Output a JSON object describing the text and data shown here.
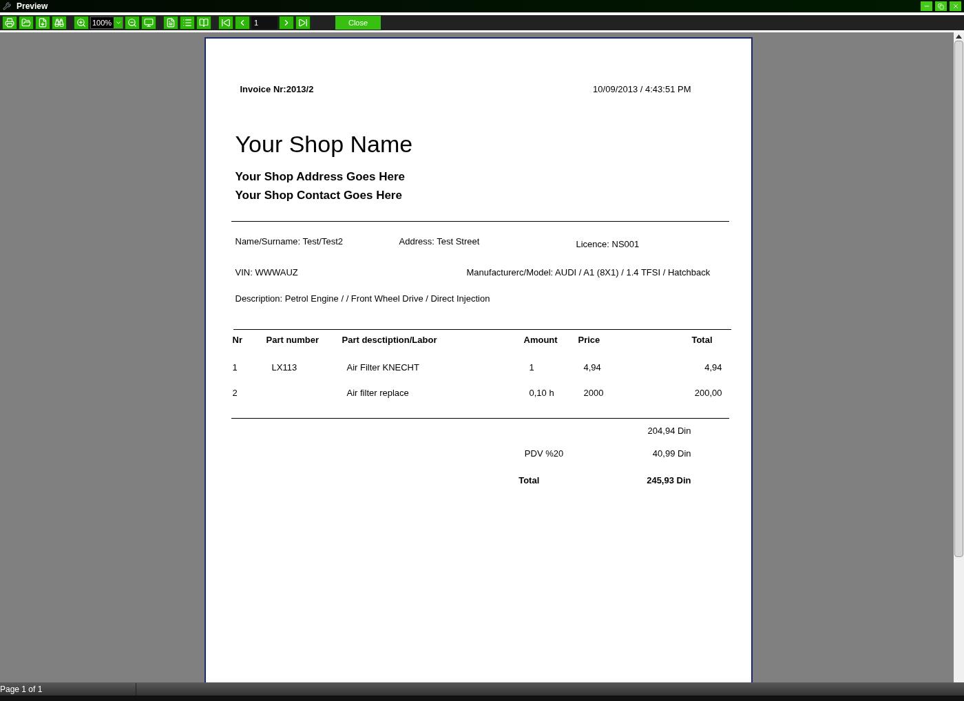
{
  "window": {
    "title": "Preview"
  },
  "toolbar": {
    "zoom": "100%",
    "page": "1",
    "close": "Close"
  },
  "invoice": {
    "number": "Invoice Nr:2013/2",
    "datetime": "10/09/2013 / 4:43:51 PM",
    "shop_name": "Your Shop Name",
    "shop_address": "Your Shop Address Goes Here",
    "shop_contact": "Your Shop Contact Goes Here",
    "name": "Name/Surname: Test/Test2",
    "address": "Address: Test Street",
    "licence": "Licence: NS001",
    "vin": "VIN: WWWAUZ",
    "model": "Manufacturerc/Model: AUDI / A1 (8X1) / 1.4 TFSI / Hatchback",
    "description": "Description: Petrol Engine /  / Front Wheel Drive / Direct Injection",
    "columns": [
      "Nr",
      "Part number",
      "Part desctiption/Labor",
      "Amount",
      "Price",
      "Total"
    ],
    "rows": [
      {
        "nr": "1",
        "part": "LX113",
        "desc": "Air Filter KNECHT",
        "amount": "1",
        "price": "4,94",
        "total": "4,94"
      },
      {
        "nr": "2",
        "part": "",
        "desc": "Air filter replace",
        "amount": "0,10 h",
        "price": "2000",
        "total": "200,00"
      }
    ],
    "subtotal": "204,94 Din",
    "tax_label": "PDV %20",
    "tax": "40,99 Din",
    "total_label": "Total",
    "total": "245,93 Din"
  },
  "status_bar": "Page 1 of 1"
}
